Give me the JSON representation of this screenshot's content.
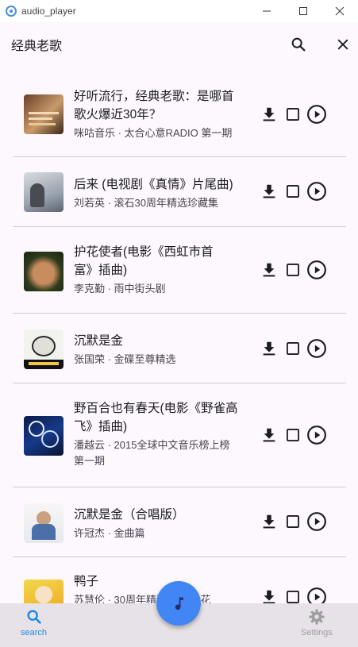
{
  "window": {
    "title": "audio_player"
  },
  "header": {
    "title": "经典老歌"
  },
  "songs": [
    {
      "title_lines": [
        "好听流行，经典老歌：是哪首",
        "歌火爆近30年？"
      ],
      "subtitle_lines": [
        "咪咕音乐 · 太合心意RADIO 第一期"
      ],
      "cover": "cover-1"
    },
    {
      "title_lines": [
        "后来 (电视剧《真情》片尾曲)"
      ],
      "subtitle_lines": [
        "刘若英 · 滚石30周年精选珍藏集"
      ],
      "cover": "cover-2"
    },
    {
      "title_lines": [
        "护花使者(电影《西虹市首",
        "富》插曲)"
      ],
      "subtitle_lines": [
        "李克勤 · 雨中街头剧"
      ],
      "cover": "cover-3"
    },
    {
      "title_lines": [
        "沉默是金"
      ],
      "subtitle_lines": [
        "张国荣 · 金碟至尊精选"
      ],
      "cover": "cover-4"
    },
    {
      "title_lines": [
        "野百合也有春天(电影《野雀高",
        "飞》插曲)"
      ],
      "subtitle_lines": [
        "潘越云 · 2015全球中文音乐榜上榜",
        "第一期"
      ],
      "cover": "cover-5"
    },
    {
      "title_lines": [
        "沉默是金（合唱版）"
      ],
      "subtitle_lines": [
        "许冠杰 · 金曲篇"
      ],
      "cover": "cover-6"
    },
    {
      "title_lines": [
        "鸭子"
      ],
      "subtitle_lines": [
        "苏慧伦 · 30周年精选 生命之花"
      ],
      "cover": "cover-7"
    }
  ],
  "nav": {
    "search_label": "search",
    "settings_label": "Settings"
  },
  "colors": {
    "accent": "#4285f4",
    "nav_active": "#1e88e5",
    "nav_inactive": "#9e9e9e"
  }
}
